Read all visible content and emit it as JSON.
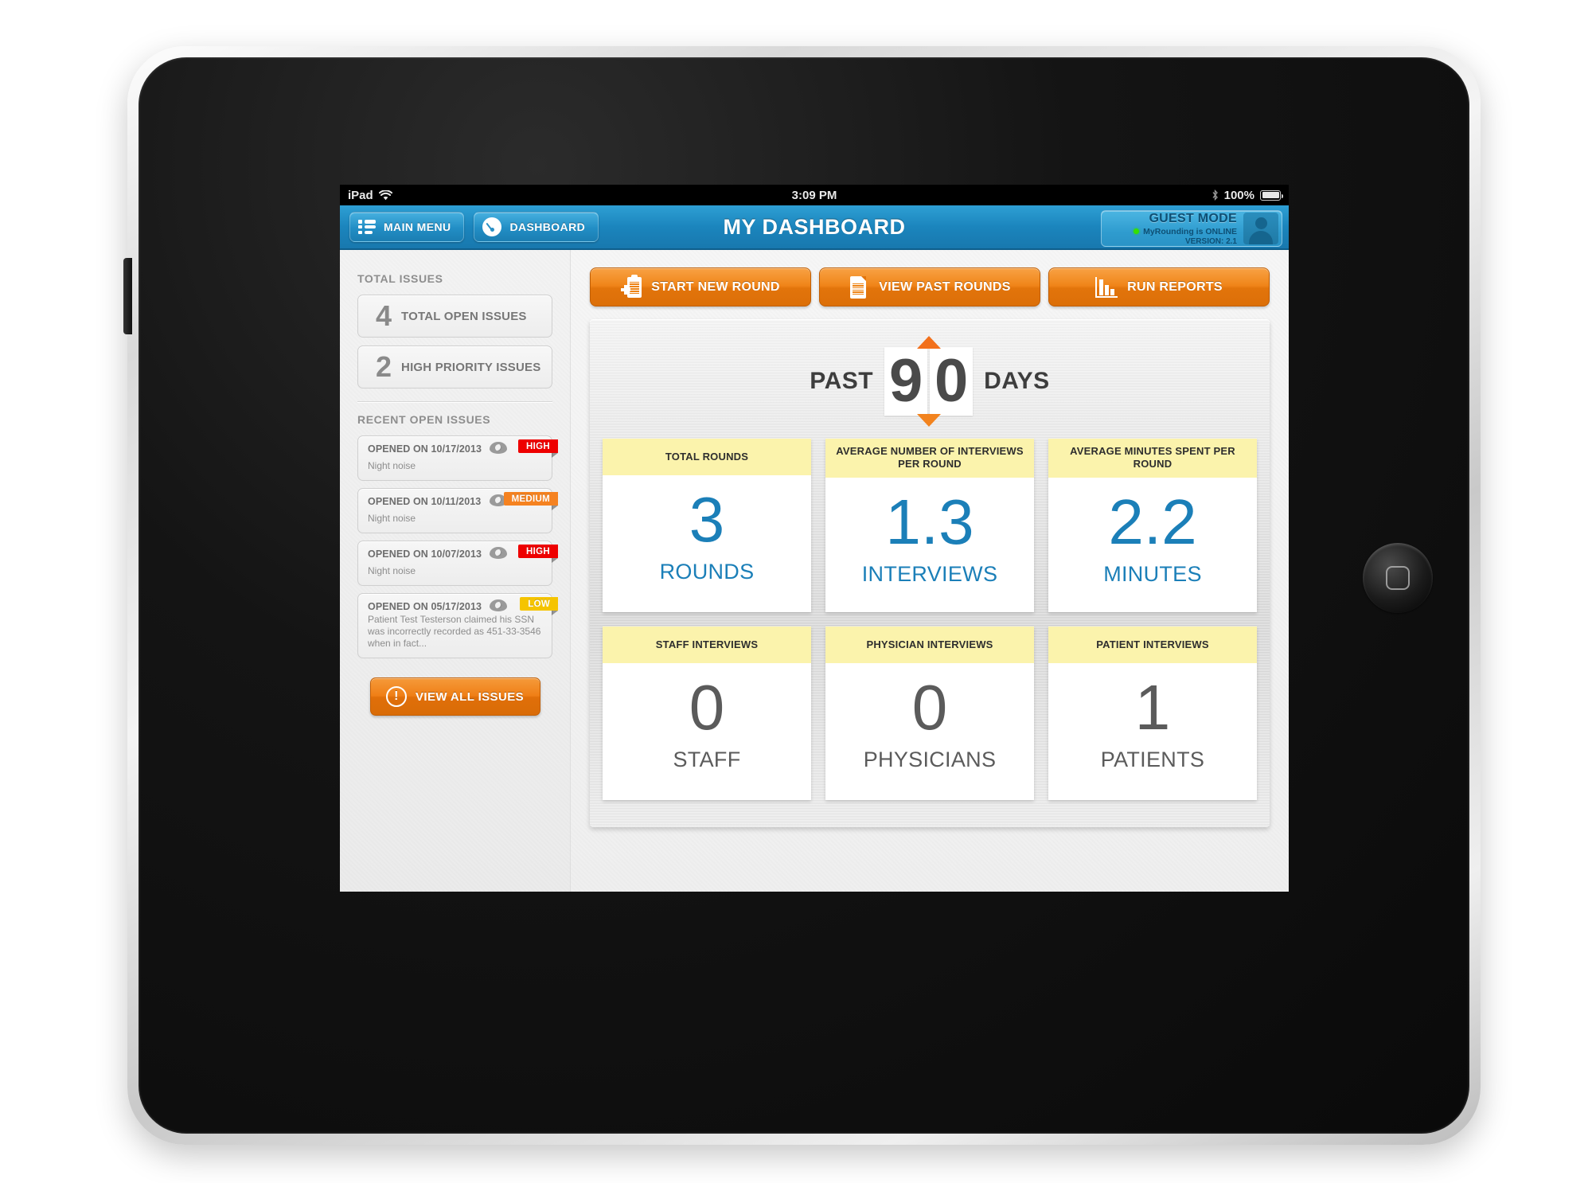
{
  "status_bar": {
    "device": "iPad",
    "wifi_icon": "wifi-icon",
    "time": "3:09 PM",
    "bluetooth_icon": "bluetooth-icon",
    "battery_percent": "100%"
  },
  "navbar": {
    "main_menu_label": "MAIN MENU",
    "dashboard_label": "DASHBOARD",
    "title": "MY DASHBOARD",
    "guest": {
      "title": "GUEST MODE",
      "status": "MyRounding is ONLINE",
      "version": "VERSION: 2.1"
    }
  },
  "sidebar": {
    "total_issues_label": "TOTAL ISSUES",
    "counts": [
      {
        "number": "4",
        "label": "TOTAL OPEN ISSUES"
      },
      {
        "number": "2",
        "label": "HIGH PRIORITY ISSUES"
      }
    ],
    "recent_label": "RECENT OPEN ISSUES",
    "issues": [
      {
        "date": "OPENED ON 10/17/2013",
        "desc": "Night noise",
        "priority": "HIGH"
      },
      {
        "date": "OPENED ON 10/11/2013",
        "desc": "Night noise",
        "priority": "MEDIUM"
      },
      {
        "date": "OPENED ON 10/07/2013",
        "desc": "Night noise",
        "priority": "HIGH"
      },
      {
        "date": "OPENED ON 05/17/2013",
        "desc": "Patient Test Testerson claimed his SSN was incorrectly recorded as 451-33-3546 when in fact...",
        "priority": "LOW"
      }
    ],
    "view_all_label": "VIEW ALL ISSUES",
    "view_all_icon": "exclamation-circle-icon"
  },
  "actions": [
    {
      "label": "START NEW ROUND",
      "icon": "clipboard-plus-icon"
    },
    {
      "label": "VIEW PAST ROUNDS",
      "icon": "document-icon"
    },
    {
      "label": "RUN REPORTS",
      "icon": "bar-chart-icon"
    }
  ],
  "period": {
    "prefix": "PAST",
    "digits": [
      "9",
      "0"
    ],
    "suffix": "DAYS",
    "up_arrow_icon": "arrow-up-icon",
    "down_arrow_icon": "arrow-down-icon"
  },
  "stats": [
    {
      "title": "TOTAL ROUNDS",
      "value": "3",
      "unit": "ROUNDS",
      "color": "blue"
    },
    {
      "title": "AVERAGE NUMBER OF INTERVIEWS PER ROUND",
      "value": "1.3",
      "unit": "INTERVIEWS",
      "color": "blue"
    },
    {
      "title": "AVERAGE MINUTES SPENT PER ROUND",
      "value": "2.2",
      "unit": "MINUTES",
      "color": "blue"
    },
    {
      "title": "STAFF INTERVIEWS",
      "value": "0",
      "unit": "STAFF",
      "color": "gray"
    },
    {
      "title": "PHYSICIAN INTERVIEWS",
      "value": "0",
      "unit": "PHYSICIANS",
      "color": "gray"
    },
    {
      "title": "PATIENT INTERVIEWS",
      "value": "1",
      "unit": "PATIENTS",
      "color": "gray"
    }
  ],
  "colors": {
    "brand_blue": "#1b85bd",
    "accent_orange": "#ef7f16",
    "stat_blue": "#1b7fb8",
    "header_yellow": "#fbf3ac",
    "priority_high": "#ee0000",
    "priority_medium": "#f58220",
    "priority_low": "#f5c400"
  }
}
